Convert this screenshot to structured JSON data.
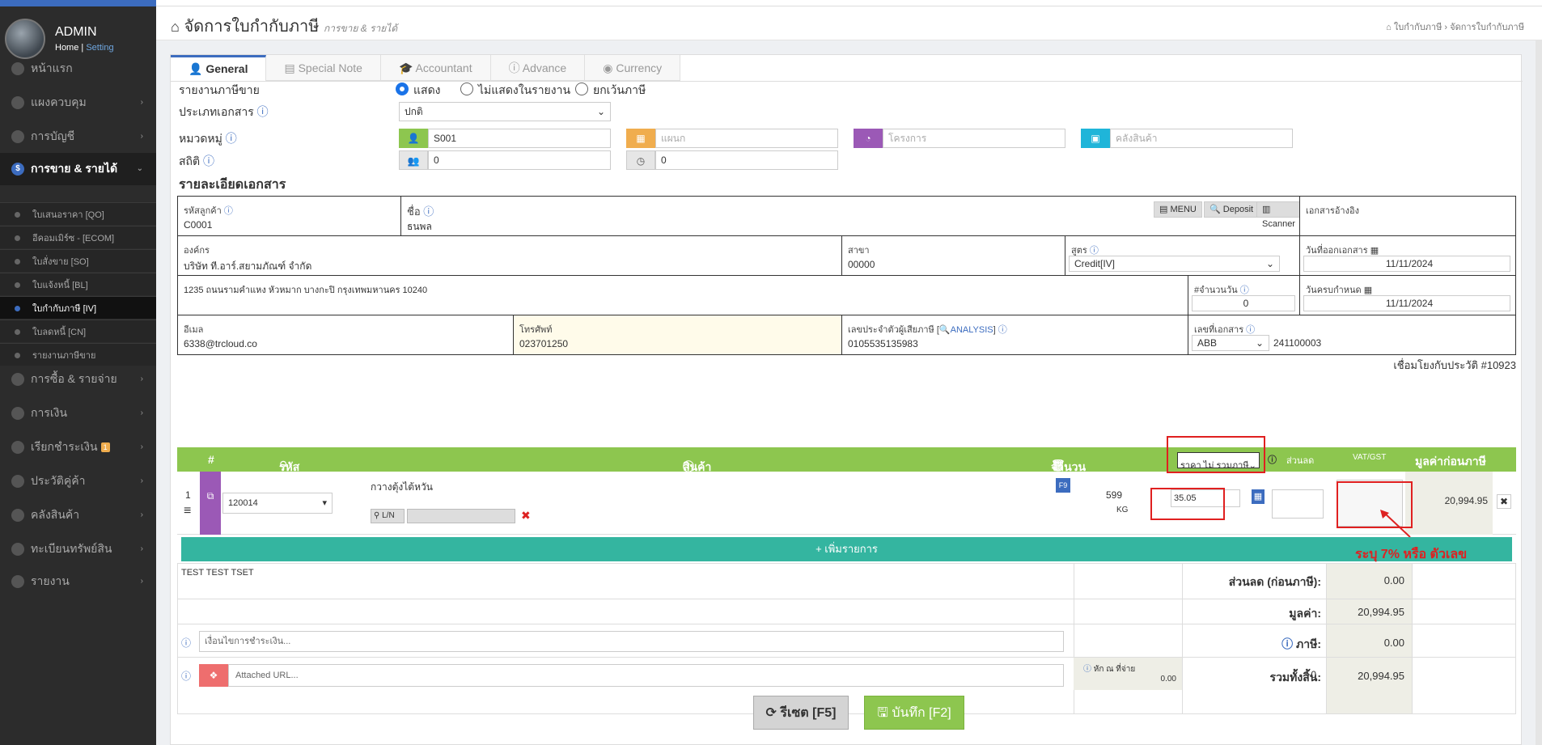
{
  "sidebar": {
    "user": "ADMIN",
    "home": "Home",
    "setting": "Setting",
    "items": [
      {
        "label": "หน้าแรก",
        "icon": "cloud-icon"
      },
      {
        "label": "แผงควบคุม",
        "icon": "monitor-icon"
      },
      {
        "label": "การบัญชี",
        "icon": "book-icon"
      },
      {
        "label": "การขาย & รายได้",
        "icon": "dollar-icon"
      },
      {
        "label": "การซื้อ & รายจ่าย",
        "icon": "cart-icon"
      },
      {
        "label": "การเงิน",
        "icon": "calendar-icon"
      },
      {
        "label": "เรียกชำระเงิน",
        "icon": "invoice-icon",
        "badge": "1"
      },
      {
        "label": "ประวัติคู่ค้า",
        "icon": "contact-icon"
      },
      {
        "label": "คลังสินค้า",
        "icon": "cubes-icon"
      },
      {
        "label": "ทะเบียนทรัพย์สิน",
        "icon": "diamond-icon"
      },
      {
        "label": "รายงาน",
        "icon": "copy-icon"
      }
    ],
    "subitems": [
      "ใบเสนอราคา [QO]",
      "อีคอมเมิร์ซ - [ECOM]",
      "ใบสั่งขาย [SO]",
      "ใบแจ้งหนี้ [BL]",
      "ใบกำกับภาษี [IV]",
      "ใบลดหนี้ [CN]",
      "รายงานภาษีขาย"
    ]
  },
  "header": {
    "title": "จัดการใบกำกับภาษี",
    "subtitle": "การขาย & รายได้",
    "crumb1": "ใบกำกับภาษี",
    "crumb2": "จัดการใบกำกับภาษี"
  },
  "tabs": [
    "General",
    "Special Note",
    "Accountant",
    "Advance",
    "Currency"
  ],
  "form": {
    "report_label": "รายงานภาษีขาย",
    "radio": [
      "แสดง",
      "ไม่แสดงในรายงาน",
      "ยกเว้นภาษี"
    ],
    "doctype_label": "ประเภทเอกสาร",
    "doctype_value": "ปกติ",
    "group_label": "หมวดหมู่",
    "group_value": "S001",
    "dept_ph": "แผนก",
    "project_ph": "โครงการ",
    "warehouse_ph": "คลังสินค้า",
    "stat_label": "สถิติ",
    "stat1": "0",
    "stat2": "0",
    "section": "รายละเอียดเอกสาร"
  },
  "doc": {
    "cust_code_label": "รหัสลูกค้า",
    "cust_code": "C0001",
    "name_label": "ชื่อ",
    "name": "ธนพล",
    "menu_btn": "MENU",
    "deposit_btn": "Deposit",
    "scanner_btn": "Scanner",
    "ref_label": "เอกสารอ้างอิง",
    "org_label": "องค์กร",
    "org": "บริษัท ที.อาร์.สยามภัณฑ์ จำกัด",
    "branch_label": "สาขา",
    "branch": "00000",
    "formula_label": "สูตร",
    "formula": "Credit[IV]",
    "issue_label": "วันที่ออกเอกสาร",
    "issue_date": "11/11/2024",
    "address": "1235 ถนนรามคำแหง หัวหมาก บางกะปิ กรุงเทพมหานคร 10240",
    "days_label": "#จำนวนวัน",
    "days": "0",
    "due_label": "วันครบกำหนด",
    "due_date": "11/11/2024",
    "email_label": "อีเมล",
    "email": "6338@trcloud.co",
    "phone_label": "โทรศัพท์",
    "phone": "023701250",
    "taxid_label": "เลขประจำตัวผู้เสียภาษี [",
    "analysis": "ANALYSIS",
    "taxid_end": "]",
    "taxid": "0105535135983",
    "docno_label": "เลขที่เอกสาร",
    "docno_prefix": "ABB",
    "docno": "241100003",
    "history": "เชื่อมโยงกับประวัติ #10923"
  },
  "grid": {
    "h_num": "#",
    "h_code": "รหัส",
    "h_product": "สินค้า",
    "h_qty": "จำนวน",
    "h_price_select": "ราคา ไม่ รวมภาษี",
    "h_discount": "ส่วนลด",
    "h_vat": "VAT/GST",
    "h_net": "มูลค่าก่อนภาษี",
    "row": {
      "no": "1",
      "code": "120014",
      "desc": "กวางตุ้งไต้หวัน",
      "ln": "L/N",
      "f9": "F9",
      "qty": "599",
      "unit": "KG",
      "price": "35.05",
      "net": "20,994.95"
    },
    "add_btn": "+ เพิ่มรายการ",
    "annotation": "ระบุ 7% หรือ ตัวเลข"
  },
  "footer": {
    "note": "TEST TEST TSET",
    "pay_ph": "เงื่อนไขการชำระเงิน...",
    "url_ph": "Attached URL...",
    "wht_label": "หัก ณ ที่จ่าย",
    "wht_val": "0.00",
    "wht_amount": "0",
    "discount_label": "ส่วนลด (ก่อนภาษี):",
    "discount": "0.00",
    "value_label": "มูลค่า:",
    "value": "20,994.95",
    "tax_label": "ภาษี:",
    "tax": "0.00",
    "total_label": "รวมทั้งสิ้น:",
    "total": "20,994.95",
    "reset_btn": "รีเซต [F5]",
    "save_btn": "บันทึก [F2]"
  }
}
